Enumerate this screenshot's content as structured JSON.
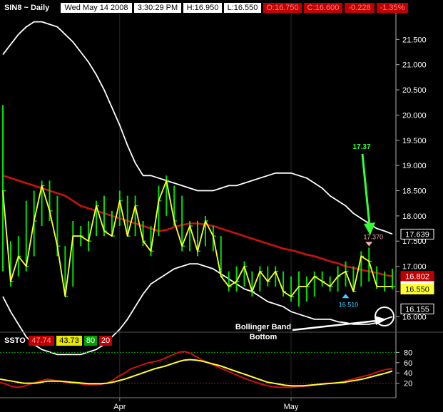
{
  "header": {
    "symbol": "SIN8 ~ Daily",
    "date": "Wed May 14 2008",
    "time": "3:30:29 PM",
    "high": "H:16.950",
    "low": "L:16.550",
    "open": "O:16.750",
    "close": "C:16.600",
    "change": "-0.228",
    "change_pct": "-1.35%"
  },
  "lower_panel": {
    "label": "SSTO",
    "badges": [
      {
        "text": "47.74",
        "bg": "#c00000",
        "fg": "#ff9090"
      },
      {
        "text": "43.73",
        "bg": "#e8e800",
        "fg": "#000000"
      },
      {
        "text": "80",
        "bg": "#00a000",
        "fg": "#ffffff"
      },
      {
        "text": "20",
        "bg": "#c00000",
        "fg": "#ffffff"
      }
    ]
  },
  "colors": {
    "background": "#000000",
    "price_bars": "#00e000",
    "close_line": "#ffff33",
    "moving_average": "#cc1111",
    "bollinger": "#ffffff",
    "stoch_k": "#cc1111",
    "stoch_d": "#ffff33",
    "overbought": "#00a000",
    "oversold": "#c00000"
  },
  "chart_data": [
    {
      "type": "line",
      "panel": "price",
      "y_ticks": [
        "21.500",
        "21.000",
        "20.500",
        "20.000",
        "19.500",
        "19.000",
        "18.500",
        "18.000",
        "17.500",
        "17.000",
        "16.500",
        "16.000"
      ],
      "ylim": [
        15.75,
        22.0
      ],
      "x_labels": [
        "Apr",
        "May"
      ],
      "x_label_index": [
        15,
        37
      ],
      "ohlc": [
        {
          "h": 20.2,
          "l": 16.9,
          "c": 18.5
        },
        {
          "h": 17.5,
          "l": 16.6,
          "c": 16.7
        },
        {
          "h": 17.6,
          "l": 16.8,
          "c": 17.2
        },
        {
          "h": 18.3,
          "l": 16.9,
          "c": 17.0
        },
        {
          "h": 18.5,
          "l": 17.2,
          "c": 17.9
        },
        {
          "h": 18.7,
          "l": 17.8,
          "c": 18.6
        },
        {
          "h": 18.7,
          "l": 17.9,
          "c": 18.1
        },
        {
          "h": 18.4,
          "l": 17.2,
          "c": 17.4
        },
        {
          "h": 17.4,
          "l": 16.4,
          "c": 16.4
        },
        {
          "h": 17.9,
          "l": 16.6,
          "c": 17.6
        },
        {
          "h": 17.8,
          "l": 17.4,
          "c": 17.6
        },
        {
          "h": 17.9,
          "l": 17.3,
          "c": 17.5
        },
        {
          "h": 18.3,
          "l": 17.6,
          "c": 18.2
        },
        {
          "h": 18.4,
          "l": 17.6,
          "c": 17.7
        },
        {
          "h": 18.1,
          "l": 17.6,
          "c": 17.6
        },
        {
          "h": 18.5,
          "l": 17.8,
          "c": 18.3
        },
        {
          "h": 18.4,
          "l": 17.6,
          "c": 17.6
        },
        {
          "h": 18.4,
          "l": 17.6,
          "c": 18.2
        },
        {
          "h": 17.9,
          "l": 17.4,
          "c": 17.5
        },
        {
          "h": 17.8,
          "l": 17.2,
          "c": 17.3
        },
        {
          "h": 18.6,
          "l": 17.6,
          "c": 18.3
        },
        {
          "h": 18.8,
          "l": 18.0,
          "c": 18.7
        },
        {
          "h": 18.6,
          "l": 17.8,
          "c": 17.9
        },
        {
          "h": 18.4,
          "l": 17.3,
          "c": 17.4
        },
        {
          "h": 17.9,
          "l": 17.3,
          "c": 17.8
        },
        {
          "h": 17.9,
          "l": 17.2,
          "c": 17.3
        },
        {
          "h": 18.0,
          "l": 17.4,
          "c": 17.9
        },
        {
          "h": 17.8,
          "l": 17.3,
          "c": 17.6
        },
        {
          "h": 17.6,
          "l": 16.8,
          "c": 16.8
        },
        {
          "h": 16.9,
          "l": 16.5,
          "c": 16.6
        },
        {
          "h": 17.0,
          "l": 16.5,
          "c": 16.7
        },
        {
          "h": 17.1,
          "l": 16.6,
          "c": 17.0
        },
        {
          "h": 16.9,
          "l": 16.4,
          "c": 16.5
        },
        {
          "h": 17.0,
          "l": 16.5,
          "c": 16.9
        },
        {
          "h": 17.0,
          "l": 16.6,
          "c": 16.7
        },
        {
          "h": 17.0,
          "l": 16.6,
          "c": 16.9
        },
        {
          "h": 16.9,
          "l": 16.4,
          "c": 16.5
        },
        {
          "h": 16.8,
          "l": 16.3,
          "c": 16.4
        },
        {
          "h": 16.9,
          "l": 16.2,
          "c": 16.6
        },
        {
          "h": 16.8,
          "l": 16.3,
          "c": 16.6
        },
        {
          "h": 16.9,
          "l": 16.4,
          "c": 16.8
        },
        {
          "h": 16.9,
          "l": 16.6,
          "c": 16.7
        },
        {
          "h": 16.8,
          "l": 16.5,
          "c": 16.6
        },
        {
          "h": 17.0,
          "l": 16.5,
          "c": 16.8
        },
        {
          "h": 17.1,
          "l": 16.6,
          "c": 16.9
        },
        {
          "h": 17.0,
          "l": 16.5,
          "c": 16.5
        },
        {
          "h": 17.3,
          "l": 16.6,
          "c": 17.2
        },
        {
          "h": 17.37,
          "l": 16.7,
          "c": 17.1
        },
        {
          "h": 17.0,
          "l": 16.55,
          "c": 16.6
        },
        {
          "h": 16.9,
          "l": 16.5,
          "c": 16.6
        },
        {
          "h": 16.95,
          "l": 16.55,
          "c": 16.6
        }
      ],
      "upper_band": [
        21.2,
        21.4,
        21.6,
        21.75,
        21.85,
        21.85,
        21.8,
        21.75,
        21.6,
        21.45,
        21.25,
        21.05,
        20.8,
        20.5,
        20.15,
        19.8,
        19.4,
        19.05,
        18.8,
        18.8,
        18.75,
        18.7,
        18.65,
        18.6,
        18.55,
        18.5,
        18.5,
        18.5,
        18.55,
        18.6,
        18.6,
        18.65,
        18.7,
        18.75,
        18.8,
        18.85,
        18.85,
        18.85,
        18.8,
        18.75,
        18.65,
        18.55,
        18.4,
        18.3,
        18.2,
        18.05,
        17.95,
        17.85,
        17.75,
        17.7,
        17.64
      ],
      "middle_band": [
        18.8,
        18.75,
        18.7,
        18.65,
        18.6,
        18.55,
        18.5,
        18.45,
        18.4,
        18.3,
        18.2,
        18.15,
        18.1,
        18.05,
        18.0,
        17.95,
        17.9,
        17.85,
        17.8,
        17.75,
        17.7,
        17.72,
        17.78,
        17.82,
        17.85,
        17.85,
        17.83,
        17.8,
        17.75,
        17.7,
        17.65,
        17.6,
        17.55,
        17.5,
        17.45,
        17.4,
        17.35,
        17.32,
        17.28,
        17.23,
        17.2,
        17.15,
        17.1,
        17.06,
        17.0,
        16.97,
        16.93,
        16.9,
        16.87,
        16.83,
        16.8
      ],
      "lower_band": [
        16.4,
        16.1,
        15.85,
        15.6,
        15.45,
        15.35,
        15.3,
        15.25,
        15.25,
        15.25,
        15.25,
        15.3,
        15.35,
        15.45,
        15.6,
        15.75,
        15.95,
        16.2,
        16.45,
        16.65,
        16.75,
        16.85,
        16.95,
        17.0,
        17.05,
        17.05,
        17.0,
        16.95,
        16.85,
        16.75,
        16.65,
        16.55,
        16.5,
        16.4,
        16.3,
        16.25,
        16.2,
        16.1,
        16.05,
        16.0,
        15.95,
        15.95,
        15.95,
        15.9,
        15.88,
        15.85,
        15.85,
        15.85,
        15.88,
        15.95,
        16.0
      ],
      "price_tags": [
        {
          "text": "17.639",
          "value": 17.639,
          "bg": "#000000",
          "fg": "#ffffff",
          "border": "#ffffff"
        },
        {
          "text": "16.802",
          "value": 16.802,
          "bg": "#c00000",
          "fg": "#ffffff",
          "border": "#c00000"
        },
        {
          "text": "16.600",
          "value": 16.6,
          "bg": "#ffffff",
          "fg": "#000000",
          "border": "#ffffff"
        },
        {
          "text": "16.550",
          "value": 16.55,
          "bg": "#ffff33",
          "fg": "#000000",
          "border": "#ffff33"
        },
        {
          "text": "16.155",
          "value": 16.155,
          "bg": "#000000",
          "fg": "#ffffff",
          "border": "#ffffff"
        }
      ],
      "annotations": {
        "high_marker": "17.370",
        "high_value": 17.37,
        "high_index": 47,
        "low_marker": "16.510",
        "low_value": 16.51,
        "low_index": 44,
        "arrow_label": "17.37",
        "note_line1": "Bollinger Band",
        "note_line2": "Bottom"
      }
    },
    {
      "type": "line",
      "panel": "stochastic",
      "y_ticks": [
        "80",
        "60",
        "40",
        "20"
      ],
      "ylim": [
        0,
        100
      ],
      "levels": [
        80,
        20
      ],
      "series": [
        {
          "values": [
            22,
            18,
            14,
            12,
            14,
            18,
            22,
            25,
            28,
            26,
            24,
            22,
            20,
            20,
            18,
            17,
            17,
            18,
            20,
            26,
            34,
            40,
            48,
            52,
            56,
            60,
            62,
            65,
            70,
            75,
            80,
            82,
            78,
            72,
            65,
            60,
            55,
            50,
            45,
            40,
            35,
            30,
            26,
            22,
            18,
            15,
            13,
            12,
            12,
            12,
            13,
            14,
            15,
            17,
            19,
            20,
            20,
            21,
            24,
            27,
            30,
            33,
            36,
            40,
            44,
            47,
            48
          ]
        },
        {
          "values": [
            28,
            26,
            24,
            22,
            20,
            20,
            20,
            22,
            24,
            24,
            24,
            23,
            22,
            21,
            20,
            19,
            19,
            19,
            20,
            22,
            25,
            28,
            32,
            36,
            40,
            44,
            48,
            51,
            54,
            58,
            62,
            65,
            66,
            65,
            63,
            60,
            57,
            54,
            50,
            46,
            42,
            38,
            34,
            30,
            26,
            22,
            20,
            18,
            16,
            15,
            15,
            15,
            16,
            17,
            18,
            19,
            20,
            21,
            22,
            24,
            26,
            28,
            31,
            34,
            37,
            40,
            43.73
          ]
        }
      ]
    }
  ]
}
